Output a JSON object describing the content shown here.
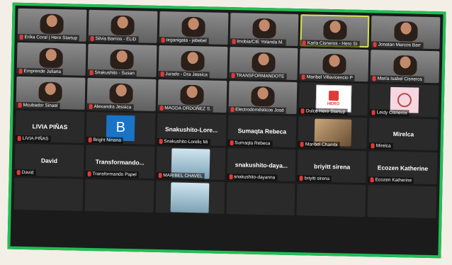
{
  "colors": {
    "border": "#1fbf55",
    "active_speaker": "#d8e24a",
    "mic_muted": "#e53935"
  },
  "tiles": [
    {
      "name": "Erika Coral | Hero Startup",
      "type": "video"
    },
    {
      "name": "Silvia Barrios - ELiD",
      "type": "video"
    },
    {
      "name": "organigata - jebebel",
      "type": "video"
    },
    {
      "name": "Imobia/CIE Yolanda M.",
      "type": "video"
    },
    {
      "name": "Karla Cisneros - Hero St",
      "type": "video-active"
    },
    {
      "name": "Jonatan Marcos Barr",
      "type": "video"
    },
    {
      "name": "Emprende Juliana",
      "type": "video"
    },
    {
      "name": "Snakushito - Susan",
      "type": "video"
    },
    {
      "name": "Jurado - Dra Jessica",
      "type": "video"
    },
    {
      "name": "TRANSFORMANDOTE",
      "type": "video"
    },
    {
      "name": "Maribel Villavicencio P",
      "type": "video"
    },
    {
      "name": "María Isabel Cisneros",
      "type": "video"
    },
    {
      "name": "Mcubador Sinael",
      "type": "video"
    },
    {
      "name": "Alexandra Jessica",
      "type": "video"
    },
    {
      "name": "MAGDA ORDOÑEZ S.",
      "type": "video"
    },
    {
      "name": "Electrodomésticos José",
      "type": "video"
    },
    {
      "name": "Dulce Hero Startup",
      "type": "hero"
    },
    {
      "name": "Leidy Cisneros",
      "type": "dream"
    },
    {
      "name": "LIVIA PIÑAS",
      "big": "LIVIA PIÑAS",
      "type": "text"
    },
    {
      "name": "Bright Ninana",
      "type": "bavatar"
    },
    {
      "name": "Snakushito-Lorelic Mi",
      "big": "Snakushito-Lore...",
      "type": "text"
    },
    {
      "name": "Sumaqta Rebeca",
      "big": "Sumaqta Rebeca",
      "type": "text"
    },
    {
      "name": "Maribel Chambi",
      "type": "dog"
    },
    {
      "name": "Mirelca",
      "big": "Mirelca",
      "type": "text"
    },
    {
      "name": "David",
      "big": "David",
      "type": "text"
    },
    {
      "name": "Transformando Papel",
      "big": "Transformando...",
      "type": "text"
    },
    {
      "name": "MARIBEL CHAVEL",
      "type": "photo"
    },
    {
      "name": "snakushito-dayanna",
      "big": "snakushito-daya...",
      "type": "text"
    },
    {
      "name": "briyitt sirena",
      "big": "briyitt sirena",
      "type": "text"
    },
    {
      "name": "Ecozen Katherine",
      "big": "Ecozen Katherine",
      "type": "text"
    },
    {
      "name": "",
      "type": "empty"
    },
    {
      "name": "",
      "type": "empty"
    },
    {
      "name": "",
      "type": "photo-partial"
    },
    {
      "name": "",
      "type": "empty"
    },
    {
      "name": "",
      "type": "empty"
    },
    {
      "name": "",
      "type": "empty"
    }
  ]
}
